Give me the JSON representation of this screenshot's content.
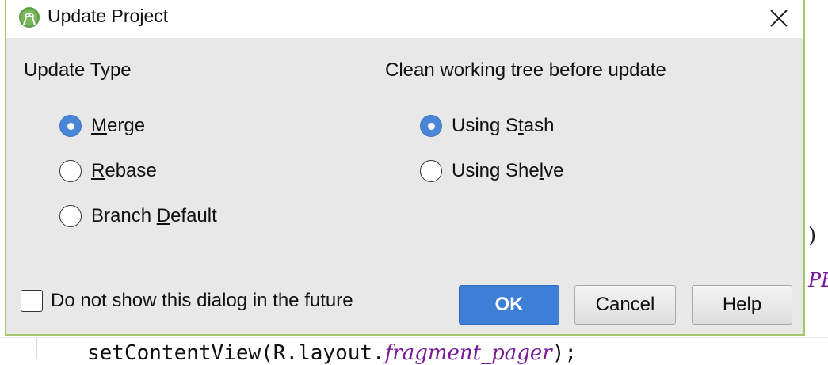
{
  "dialog": {
    "title": "Update Project",
    "close_icon": "close-icon",
    "app_icon": "android-studio-icon"
  },
  "update_type": {
    "label": "Update Type",
    "options": [
      {
        "before": "",
        "underline": "M",
        "after": "erge",
        "checked": true
      },
      {
        "before": "",
        "underline": "R",
        "after": "ebase",
        "checked": false
      },
      {
        "before": "Branch ",
        "underline": "D",
        "after": "efault",
        "checked": false
      }
    ]
  },
  "clean_tree": {
    "label": "Clean working tree before update",
    "options": [
      {
        "before": "Using S",
        "underline": "t",
        "after": "ash",
        "checked": true
      },
      {
        "before": "Using She",
        "underline": "l",
        "after": "ve",
        "checked": false
      }
    ]
  },
  "footer": {
    "dont_show_label": "Do not show this dialog in the future",
    "dont_show_checked": false,
    "ok_label": "OK",
    "cancel_label": "Cancel",
    "help_label": "Help"
  },
  "background_editor": {
    "paren": ")",
    "fragment": "PE",
    "code_prefix": "setContentView(R.layout.",
    "code_italic": "fragment_pager",
    "code_suffix": ");"
  },
  "colors": {
    "dialog_border": "#a6c86a",
    "accent_blue": "#3d7fd6",
    "dialog_bg": "#e8e8e8"
  }
}
